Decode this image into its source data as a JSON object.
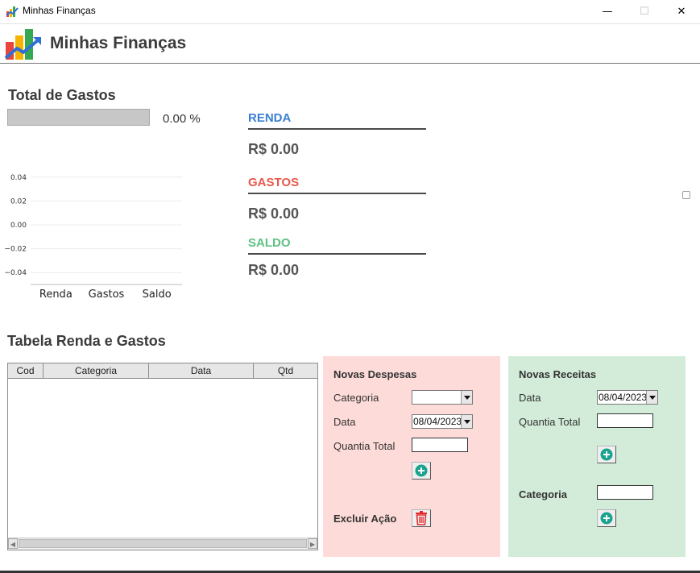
{
  "window": {
    "title": "Minhas Finanças",
    "minimize_glyph": "—",
    "maximize_glyph": "☐",
    "close_glyph": "✕"
  },
  "app": {
    "title": "Minhas Finanças",
    "logo_icon": "bar-chart-growth-icon"
  },
  "summary": {
    "title": "Total de Gastos",
    "progress_percent": 0.0,
    "progress_text": "0.00 %"
  },
  "metrics": {
    "renda": {
      "label": "RENDA",
      "value": "R$ 0.00",
      "color": "#3a7fd4"
    },
    "gastos": {
      "label": "GASTOS",
      "value": "R$ 0.00",
      "color": "#e8584b"
    },
    "saldo": {
      "label": "SALDO",
      "value": "R$ 0.00",
      "color": "#5cc183"
    }
  },
  "chart_data": {
    "type": "bar",
    "categories": [
      "Renda",
      "Gastos",
      "Saldo"
    ],
    "values": [
      0,
      0,
      0
    ],
    "ylim": [
      -0.05,
      0.05
    ],
    "yticks": [
      "0.04",
      "0.02",
      "0.00",
      "−0.02",
      "−0.04"
    ],
    "ytick_values": [
      0.04,
      0.02,
      0.0,
      -0.02,
      -0.04
    ],
    "grid": true
  },
  "table": {
    "title": "Tabela Renda e Gastos",
    "columns": [
      "Cod",
      "Categoria",
      "Data",
      "Qtd"
    ],
    "rows": [],
    "scroll_left_glyph": "◀",
    "scroll_right_glyph": "▶"
  },
  "despesas": {
    "title": "Novas Despesas",
    "categoria_label": "Categoria",
    "categoria_value": "",
    "data_label": "Data",
    "data_value": "08/04/2023",
    "quantia_label": "Quantia Total",
    "quantia_value": "",
    "excluir_label": "Excluir Ação",
    "bg_color": "#fddbd9"
  },
  "receitas": {
    "title": "Novas Receitas",
    "data_label": "Data",
    "data_value": "08/04/2023",
    "quantia_label": "Quantia Total",
    "quantia_value": "",
    "categoria_label": "Categoria",
    "categoria_value": "",
    "bg_color": "#d2ecd9"
  },
  "icons": {
    "add": "plus-circle-icon",
    "delete": "trash-icon"
  }
}
